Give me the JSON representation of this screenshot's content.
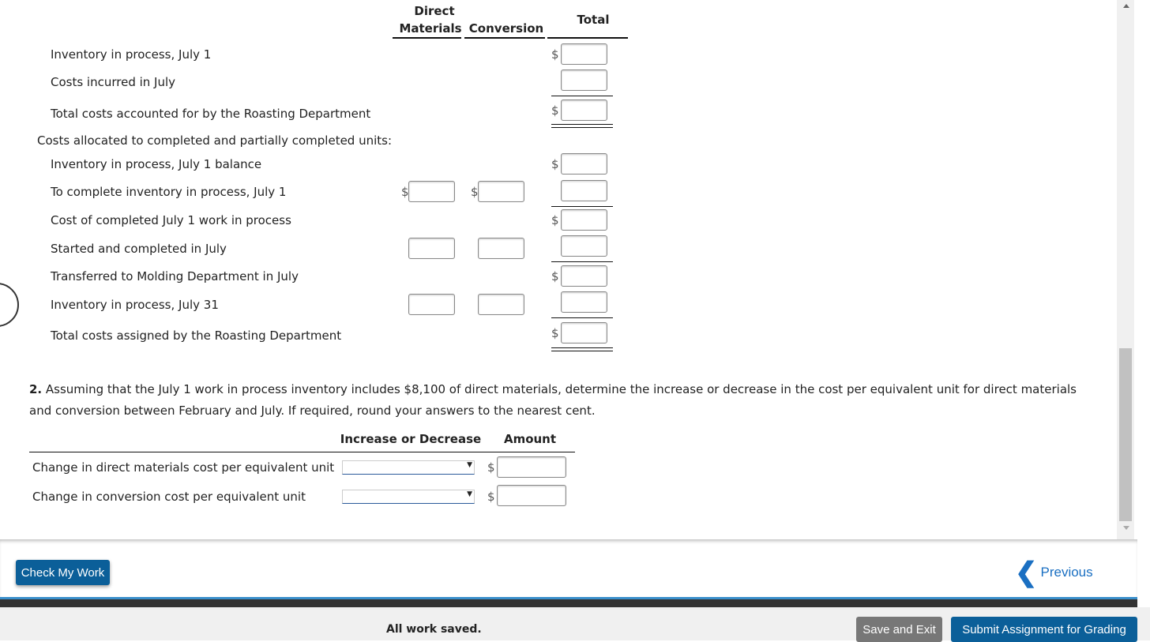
{
  "table1": {
    "headers": {
      "direct_line1": "Direct",
      "direct_line2": "Materials",
      "conversion": "Conversion",
      "total": "Total"
    },
    "rows": [
      "Inventory in process, July 1",
      "Costs incurred in July",
      "Total costs accounted for by the Roasting Department",
      "Costs allocated to completed and partially completed units:",
      "Inventory in process, July 1 balance",
      "To complete inventory in process, July 1",
      "Cost of completed July 1 work in process",
      "Started and completed in July",
      "Transferred to Molding Department in July",
      "Inventory in process, July 31",
      "Total costs assigned by the Roasting Department"
    ],
    "currency": "$"
  },
  "part2": {
    "number": "2.",
    "question": " Assuming that the July 1 work in process inventory includes $8,100 of direct materials, determine the increase or decrease in the cost per equivalent unit for direct materials and conversion between February and July. If required, round your answers to the nearest cent.",
    "headers": {
      "inc_dec": "Increase or Decrease",
      "amount": "Amount"
    },
    "rows": [
      "Change in direct materials cost per equivalent unit",
      "Change in conversion cost per equivalent unit"
    ],
    "select_value": ""
  },
  "footer": {
    "check": "Check My Work",
    "previous": "Previous",
    "status": "All work saved.",
    "save_exit": "Save and Exit",
    "submit": "Submit Assignment for Grading"
  },
  "colors": {
    "primary": "#0b5f99",
    "gray_button": "#777777"
  }
}
